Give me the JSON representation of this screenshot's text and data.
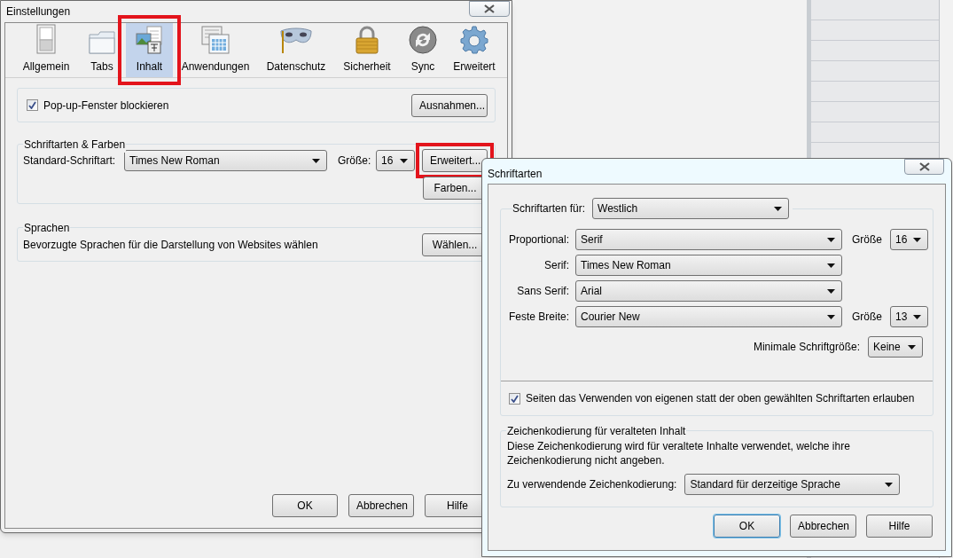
{
  "settings_window": {
    "title": "Einstellungen",
    "tabs": [
      {
        "label": "Allgemein",
        "selected": false,
        "highlighted": false
      },
      {
        "label": "Tabs",
        "selected": false,
        "highlighted": false
      },
      {
        "label": "Inhalt",
        "selected": true,
        "highlighted": true
      },
      {
        "label": "Anwendungen",
        "selected": false,
        "highlighted": false
      },
      {
        "label": "Datenschutz",
        "selected": false,
        "highlighted": false
      },
      {
        "label": "Sicherheit",
        "selected": false,
        "highlighted": false
      },
      {
        "label": "Sync",
        "selected": false,
        "highlighted": false
      },
      {
        "label": "Erweitert",
        "selected": false,
        "highlighted": false
      }
    ],
    "popup_group": {
      "checkbox": {
        "label": "Pop-up-Fenster blockieren",
        "checked": true
      },
      "button": "Ausnahmen..."
    },
    "fonts_group": {
      "caption": "Schriftarten & Farben",
      "font_label": "Standard-Schriftart:",
      "font_value": "Times New Roman",
      "size_label": "Größe:",
      "size_value": "16",
      "advanced_button": {
        "label": "Erweitert...",
        "highlighted": true
      },
      "colors_button": "Farben..."
    },
    "languages_group": {
      "caption": "Sprachen",
      "text": "Bevorzugte Sprachen für die Darstellung von Websites wählen",
      "button": "Wählen..."
    },
    "buttons": [
      "OK",
      "Abbrechen",
      "Hilfe"
    ]
  },
  "fonts_dialog": {
    "title": "Schriftarten",
    "fonts_for_label": "Schriftarten für:",
    "fonts_for_value": "Westlich",
    "rows": [
      {
        "label": "Proportional:",
        "value": "Serif",
        "size_label": "Größe",
        "size_value": "16"
      },
      {
        "label": "Serif:",
        "value": "Times New Roman"
      },
      {
        "label": "Sans Serif:",
        "value": "Arial"
      },
      {
        "label": "Feste Breite:",
        "value": "Courier New",
        "size_label": "Größe",
        "size_value": "13"
      }
    ],
    "min_size_label": "Minimale Schriftgröße:",
    "min_size_value": "Keine",
    "allow_checkbox": {
      "label": "Seiten das Verwenden von eigenen statt der oben gewählten Schriftarten erlauben",
      "checked": true
    },
    "encoding_group": {
      "caption": "Zeichenkodierung für veralteten Inhalt",
      "description": "Diese Zeichenkodierung wird für veraltete Inhalte verwendet, welche ihre Zeichenkodierung nicht angeben.",
      "label": "Zu verwendende Zeichenkodierung:",
      "value": "Standard für derzeitige Sprache"
    },
    "buttons": [
      {
        "label": "OK",
        "default": true
      },
      {
        "label": "Abbrechen",
        "default": false
      },
      {
        "label": "Hilfe",
        "default": false
      }
    ]
  }
}
